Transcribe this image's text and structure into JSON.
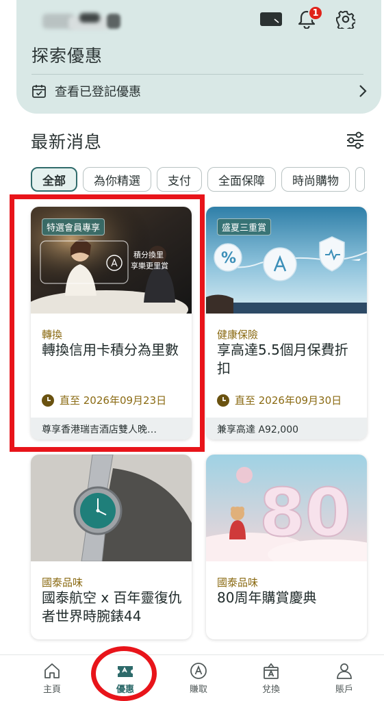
{
  "header": {
    "title": "探索優惠",
    "notification_count": "1",
    "registered_offers_label": "查看已登記優惠"
  },
  "news": {
    "section_title": "最新消息",
    "filters": [
      "全部",
      "為你精選",
      "支付",
      "全面保障",
      "時尚購物"
    ],
    "active_filter": "全部"
  },
  "cards": [
    {
      "tag": "特選會員專享",
      "image_caption_line1": "積分換里",
      "image_caption_line2": "享樂更里賞",
      "category": "轉換",
      "title": "轉換信用卡積分為里數",
      "date": "直至 2026年09月23日",
      "footer": "尊享香港瑞吉酒店雙人晚…"
    },
    {
      "tag": "盛夏三重賞",
      "category": "健康保險",
      "title": "享高達5.5個月保費折扣",
      "date": "直至 2026年09月30日",
      "footer": "兼享高達 A92,000"
    },
    {
      "category": "國泰品味",
      "title": "國泰航空 x 百年靈復仇者世界時腕錶44"
    },
    {
      "category": "國泰品味",
      "title": "80周年購賞慶典"
    }
  ],
  "bottom_nav": [
    {
      "label": "主頁",
      "icon": "home-icon"
    },
    {
      "label": "優惠",
      "icon": "offers-ticket-icon"
    },
    {
      "label": "賺取",
      "icon": "earn-asia-miles-icon"
    },
    {
      "label": "兌換",
      "icon": "redeem-gift-icon"
    },
    {
      "label": "賬戶",
      "icon": "account-person-icon"
    }
  ],
  "active_nav": "優惠",
  "colors": {
    "accent": "#2f6b6b",
    "hero_background": "#d9e8e6",
    "category_gold": "#8a6a12",
    "badge_red": "#e0231a",
    "highlight_red": "#e8141a"
  }
}
